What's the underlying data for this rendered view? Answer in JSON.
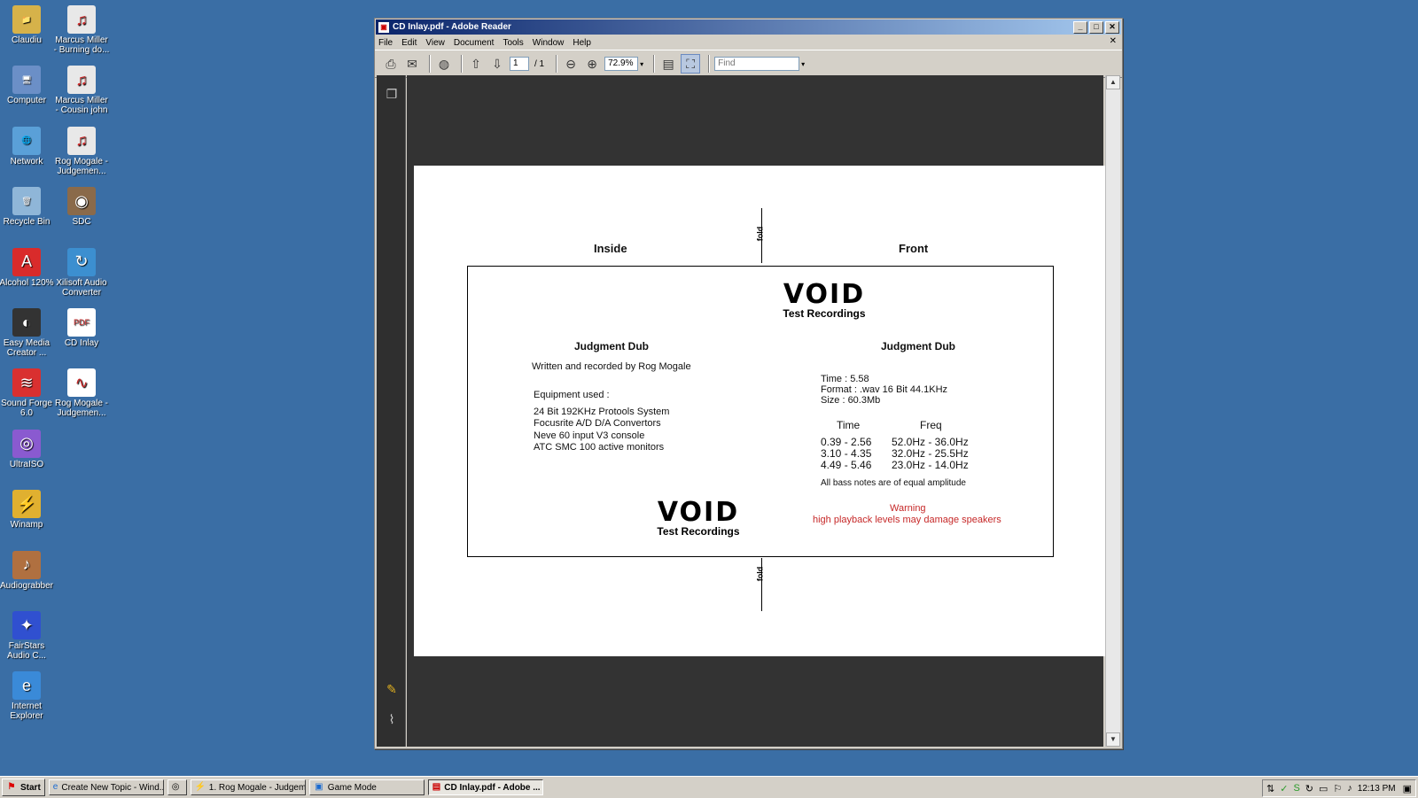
{
  "desktop": {
    "icons": [
      {
        "label": "Claudiu",
        "glyph": "📁",
        "color": "#d6b24a"
      },
      {
        "label": "Marcus Miller - Burning do...",
        "glyph": "♫",
        "color": "#e8e8e8"
      },
      {
        "label": "Computer",
        "glyph": "🖥",
        "color": "#6b8fc7"
      },
      {
        "label": "Marcus Miller - Cousin john",
        "glyph": "♫",
        "color": "#e8e8e8"
      },
      {
        "label": "Network",
        "glyph": "🌐",
        "color": "#5aa0d8"
      },
      {
        "label": "Rog Mogale - Judgemen...",
        "glyph": "♫",
        "color": "#e8e8e8"
      },
      {
        "label": "Recycle Bin",
        "glyph": "🗑",
        "color": "#8fb6d8"
      },
      {
        "label": "SDC",
        "glyph": "◉",
        "color": "#8a6a4a"
      },
      {
        "label": "Alcohol 120%",
        "glyph": "A",
        "color": "#d92b2b"
      },
      {
        "label": "Xilisoft Audio Converter",
        "glyph": "↻",
        "color": "#3c8fd0"
      },
      {
        "label": "Easy Media Creator ...",
        "glyph": "◐",
        "color": "#333333"
      },
      {
        "label": "CD Inlay",
        "glyph": "PDF",
        "color": "#ffffff"
      },
      {
        "label": "Sound Forge 6.0",
        "glyph": "≋",
        "color": "#d93030"
      },
      {
        "label": "Rog Mogale - Judgemen...",
        "glyph": "∿",
        "color": "#ffffff"
      },
      {
        "label": "UltraISO",
        "glyph": "◎",
        "color": "#8a5ad0"
      },
      {
        "label": "Winamp",
        "glyph": "⚡",
        "color": "#e0b030"
      },
      {
        "label": "Audiograbber",
        "glyph": "♪",
        "color": "#b07040"
      },
      {
        "label": "FairStars Audio C...",
        "glyph": "✦",
        "color": "#3050d0"
      },
      {
        "label": "Internet Explorer",
        "glyph": "e",
        "color": "#3a8ad8"
      }
    ]
  },
  "window": {
    "title": "CD Inlay.pdf - Adobe Reader",
    "controls": {
      "minimize": "_",
      "maximize": "□",
      "close": "✕"
    },
    "menu": [
      "File",
      "Edit",
      "View",
      "Document",
      "Tools",
      "Window",
      "Help"
    ],
    "menu_close": "✕",
    "toolbar": {
      "page_current": "1",
      "page_total": "/ 1",
      "zoom": "72.9%",
      "find_placeholder": "Find"
    }
  },
  "document": {
    "fold_label": "fold",
    "inside_label": "Inside",
    "front_label": "Front",
    "logo_word": "VOID",
    "logo_sub": "Test Recordings",
    "left": {
      "title": "Judgment Dub",
      "written": "Written and recorded by Rog Mogale",
      "equipment_heading": "Equipment used :",
      "equipment": [
        "24 Bit  192KHz  Protools System",
        "Focusrite A/D D/A Convertors",
        "Neve 60 input V3 console",
        "ATC SMC 100 active monitors"
      ]
    },
    "right": {
      "title": "Judgment Dub",
      "info": [
        "Time    : 5.58",
        "Format : .wav    16 Bit    44.1KHz",
        "Size     : 60.3Mb"
      ],
      "time_header": "Time",
      "freq_header": "Freq",
      "segments": [
        {
          "time": "0.39 - 2.56",
          "freq": "52.0Hz - 36.0Hz"
        },
        {
          "time": "3.10 - 4.35",
          "freq": "32.0Hz - 25.5Hz"
        },
        {
          "time": "4.49 - 5.46",
          "freq": "23.0Hz - 14.0Hz"
        }
      ],
      "note": "All bass notes are of equal amplitude",
      "warning_title": "Warning",
      "warning_text": "high playback levels may damage speakers"
    }
  },
  "taskbar": {
    "start": "Start",
    "items": [
      {
        "label": "Create New Topic - Wind...",
        "active": false
      },
      {
        "label": "",
        "active": false
      },
      {
        "label": "1. Rog Mogale - Judgem...",
        "active": false
      },
      {
        "label": "Game Mode",
        "active": false
      },
      {
        "label": "CD Inlay.pdf - Adobe ...",
        "active": true
      }
    ],
    "clock": "12:13 PM"
  }
}
